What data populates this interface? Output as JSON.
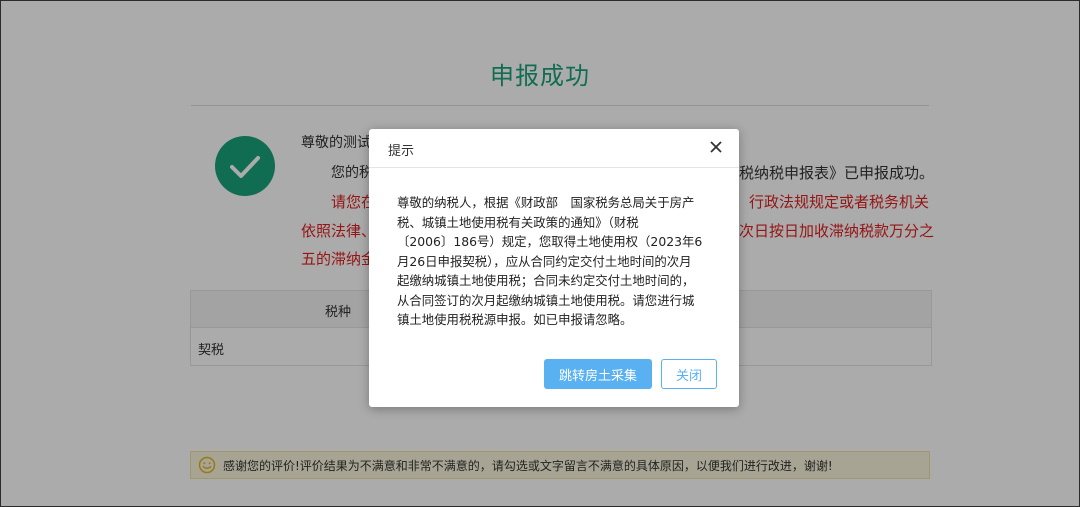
{
  "page": {
    "title": "申报成功",
    "greeting_partial": "尊敬的测试",
    "message_start": "您的税",
    "message_end": "税纳税申报表》已申报成功。",
    "warning_line1_left": "请您在",
    "warning_line1_right": "行政法规规定或者税务机关",
    "warning_line2_left": "依照法律、",
    "warning_line2_right": "次日按日加收滞纳税款万分之",
    "warning_line3_left": "五的滞纳金"
  },
  "table": {
    "header_tax_type": "税种",
    "row_tax_type": "契税"
  },
  "feedback": {
    "text": "感谢您的评价!评价结果为不满意和非常不满意的，请勾选或文字留言不满意的具体原因，以便我们进行改进，谢谢!"
  },
  "dialog": {
    "title": "提示",
    "body_lines": [
      "尊敬的纳税人，根据《财政部　国家税务总局关于房产",
      "税、城镇土地使用税有关政策的通知》（财税",
      "〔2006〕186号）规定，您取得土地使用权（2023年6",
      "月26日申报契税），应从合同约定交付土地时间的次月",
      "起缴纳城镇土地使用税；合同未约定交付土地时间的，",
      "从合同签订的次月起缴纳城镇土地使用税。请您进行城",
      "镇土地使用税税源申报。如已申报请忽略。"
    ],
    "primary_button": "跳转房土采集",
    "close_button": "关闭"
  },
  "colors": {
    "success_green": "#1aa37a",
    "warning_red": "#e02020",
    "button_blue": "#5ab1f2"
  },
  "icons": [
    "checkmark-icon",
    "close-icon",
    "smile-icon"
  ]
}
